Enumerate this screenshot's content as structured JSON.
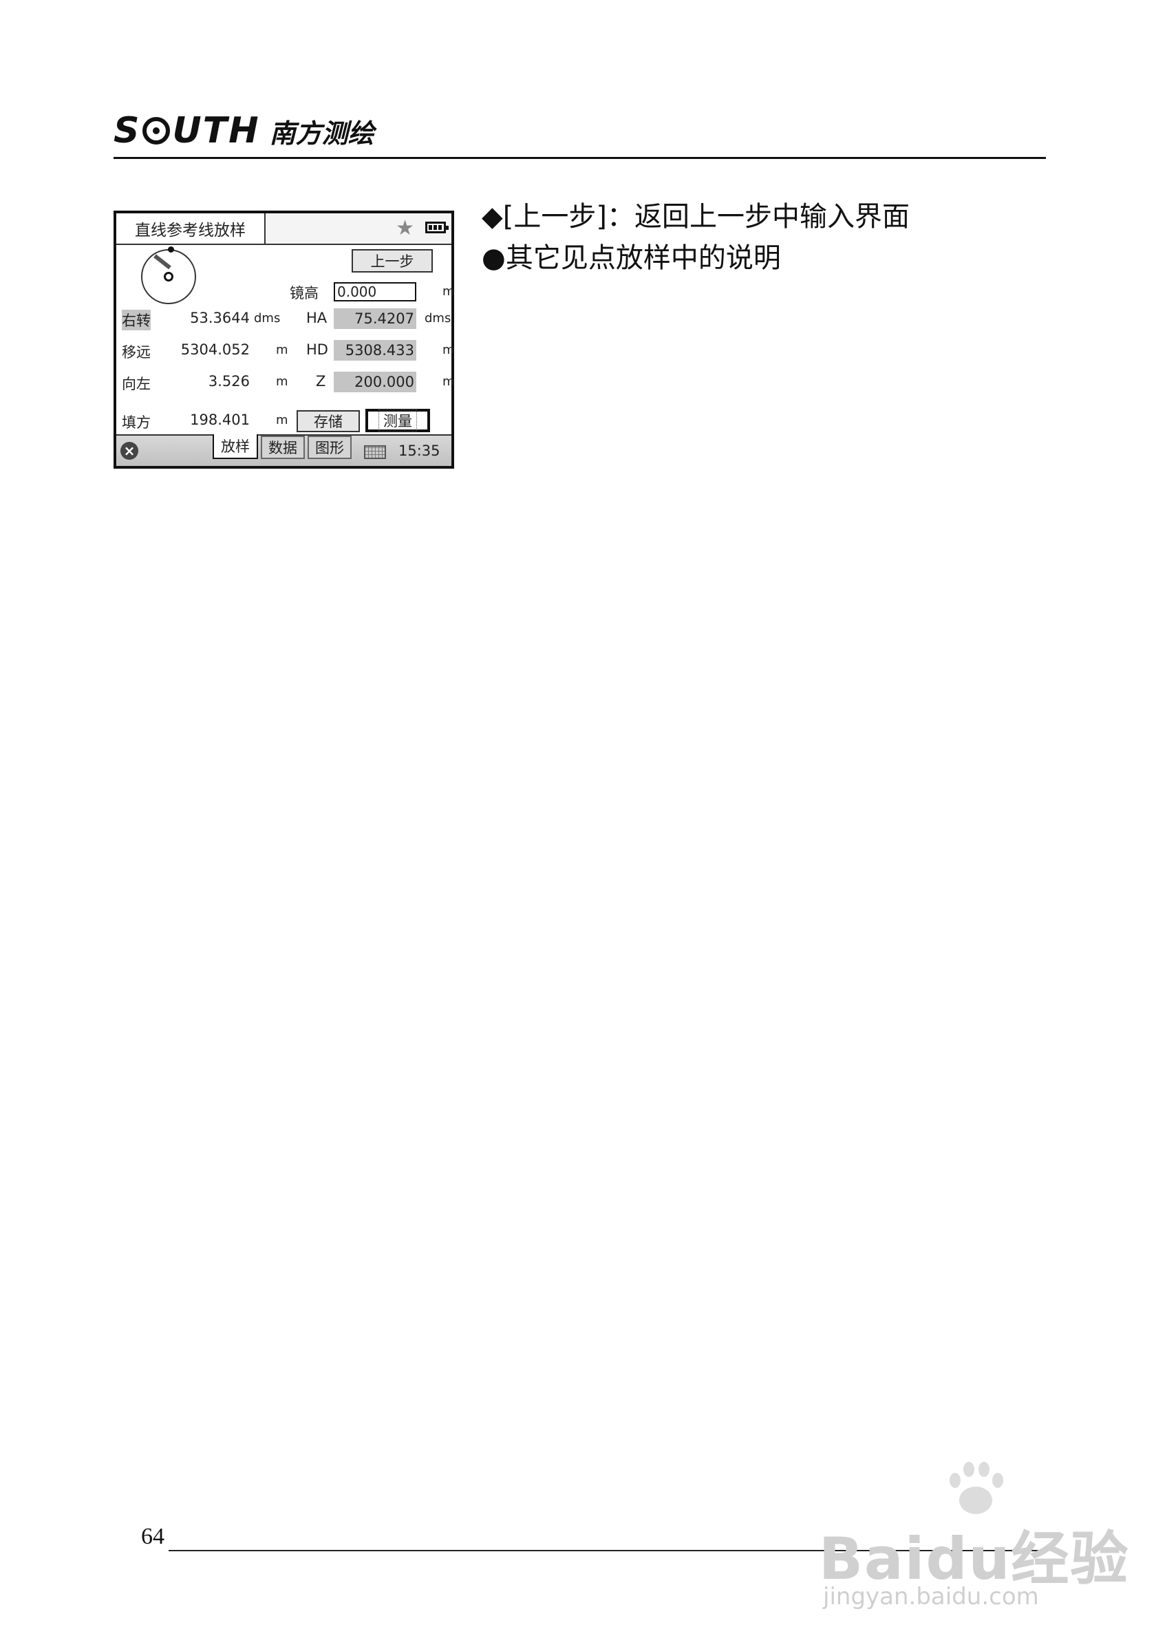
{
  "header": {
    "logo_word_left": "S",
    "logo_word_right": "UTH",
    "logo_cn": "南方测绘"
  },
  "device": {
    "title": "直线参考线放样",
    "prev_button": "上一步",
    "mirror_height_label": "镜高",
    "mirror_height_value": "0.000",
    "mirror_height_unit": "m",
    "rows": [
      {
        "label": "右转",
        "value": "53.3644",
        "unit": "dms",
        "field_label": "HA",
        "field_value": "75.4207",
        "field_unit": "dms"
      },
      {
        "label": "移远",
        "value": "5304.052",
        "unit": "m",
        "field_label": "HD",
        "field_value": "5308.433",
        "field_unit": "m"
      },
      {
        "label": "向左",
        "value": "3.526",
        "unit": "m",
        "field_label": "Z",
        "field_value": "200.000",
        "field_unit": "m"
      },
      {
        "label": "填方",
        "value": "198.401",
        "unit": "m"
      }
    ],
    "save_button": "存储",
    "measure_button": "测量",
    "tabs": [
      "放样",
      "数据",
      "图形"
    ],
    "active_tab": "放样",
    "clock": "15:35",
    "icons": [
      "star-icon",
      "battery-icon",
      "close-icon",
      "keyboard-icon"
    ]
  },
  "notes": [
    "◆[上一步]：返回上一步中输入界面",
    "●其它见点放样中的说明"
  ],
  "footer": {
    "page_number": "64"
  },
  "watermark": {
    "main": "Baidu经验",
    "sub": "jingyan.baidu.com"
  }
}
